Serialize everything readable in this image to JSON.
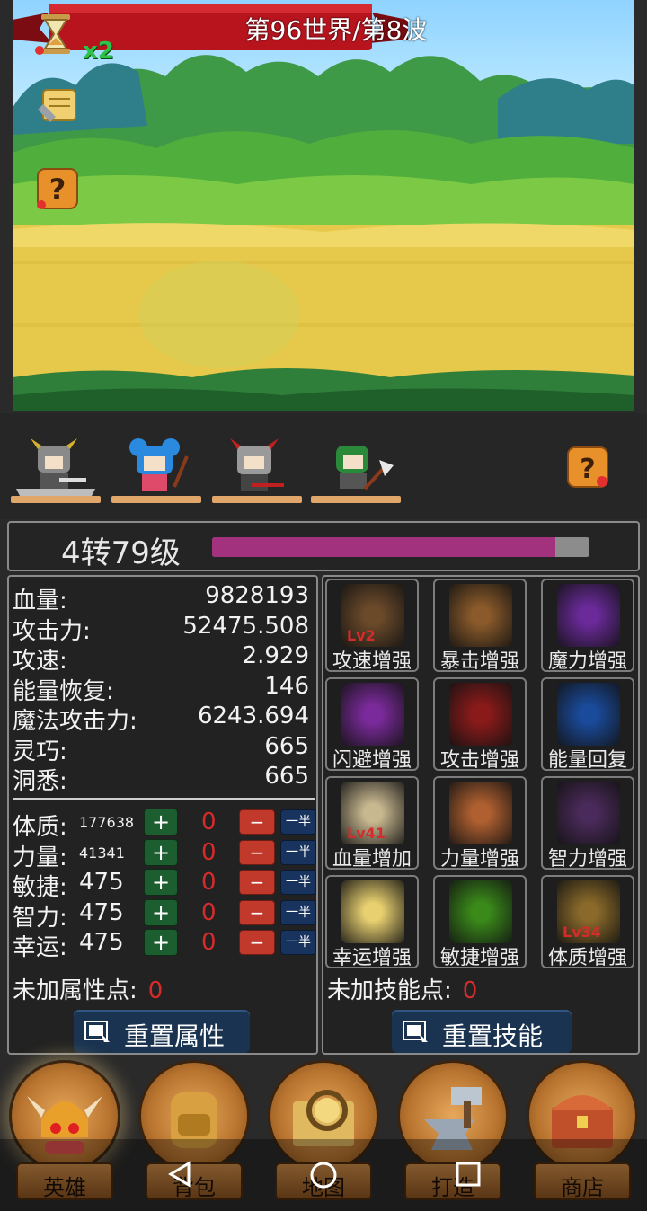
{
  "world_banner": "第96世界/第8波",
  "speed_multiplier": "x2",
  "level": {
    "label": "4转79级",
    "progress": 0.91
  },
  "stats": [
    {
      "label": "血量:",
      "value": "9828193"
    },
    {
      "label": "攻击力:",
      "value": "52475.508"
    },
    {
      "label": "攻速:",
      "value": "2.929"
    },
    {
      "label": "能量恢复:",
      "value": "146"
    },
    {
      "label": "魔法攻击力:",
      "value": "6243.694"
    },
    {
      "label": "灵巧:",
      "value": "665"
    },
    {
      "label": "洞悉:",
      "value": "665"
    }
  ],
  "attributes": [
    {
      "label": "体质:",
      "value": "177638",
      "small": true,
      "allocated": "0"
    },
    {
      "label": "力量:",
      "value": "41341",
      "small": true,
      "allocated": "0"
    },
    {
      "label": "敏捷:",
      "value": "475",
      "small": false,
      "allocated": "0"
    },
    {
      "label": "智力:",
      "value": "475",
      "small": false,
      "allocated": "0"
    },
    {
      "label": "幸运:",
      "value": "475",
      "small": false,
      "allocated": "0"
    }
  ],
  "attr_buttons": {
    "plus": "+",
    "minus": "−",
    "half": "一半"
  },
  "unassigned_attr": {
    "label": "未加属性点:",
    "value": "0"
  },
  "reset_attr_label": "重置属性",
  "skills": [
    {
      "name": "攻速增强",
      "lv": "Lv2",
      "icon": "arrows-icon",
      "color": "#6b4a2a"
    },
    {
      "name": "暴击增强",
      "lv": "",
      "icon": "target-dagger-icon",
      "color": "#8a5a2a"
    },
    {
      "name": "魔力增强",
      "lv": "",
      "icon": "magic-book-icon",
      "color": "#6a2a9a"
    },
    {
      "name": "闪避增强",
      "lv": "",
      "icon": "dodge-runner-icon",
      "color": "#7a2a9a"
    },
    {
      "name": "攻击增强",
      "lv": "",
      "icon": "red-spiral-icon",
      "color": "#8a1a1a"
    },
    {
      "name": "能量回复",
      "lv": "",
      "icon": "blue-cross-icon",
      "color": "#1a4a9a"
    },
    {
      "name": "血量增加",
      "lv": "Lv41",
      "icon": "priest-icon",
      "color": "#c8b890"
    },
    {
      "name": "力量增强",
      "lv": "",
      "icon": "muscle-arm-icon",
      "color": "#b06030"
    },
    {
      "name": "智力增强",
      "lv": "",
      "icon": "hooded-mage-icon",
      "color": "#4a2a5a"
    },
    {
      "name": "幸运增强",
      "lv": "",
      "icon": "meditation-icon",
      "color": "#e8d070"
    },
    {
      "name": "敏捷增强",
      "lv": "",
      "icon": "green-runner-icon",
      "color": "#3a8a1a"
    },
    {
      "name": "体质增强",
      "lv": "Lv34",
      "icon": "lion-shield-icon",
      "color": "#8a6a2a"
    }
  ],
  "unassigned_skill": {
    "label": "未加技能点:",
    "value": "0"
  },
  "reset_skill_label": "重置技能",
  "nav": [
    {
      "label": "英雄",
      "icon": "viking-helmet-icon",
      "active": true
    },
    {
      "label": "背包",
      "icon": "backpack-icon",
      "active": false
    },
    {
      "label": "地图",
      "icon": "map-magnifier-icon",
      "active": false
    },
    {
      "label": "打造",
      "icon": "anvil-hammer-icon",
      "active": false
    },
    {
      "label": "商店",
      "icon": "treasure-chest-icon",
      "active": false
    }
  ],
  "colors": {
    "xp_fill": "#a3327e",
    "banner": "#b8141e",
    "count_red": "#d62b2b",
    "plus_green": "#1c5e30"
  }
}
